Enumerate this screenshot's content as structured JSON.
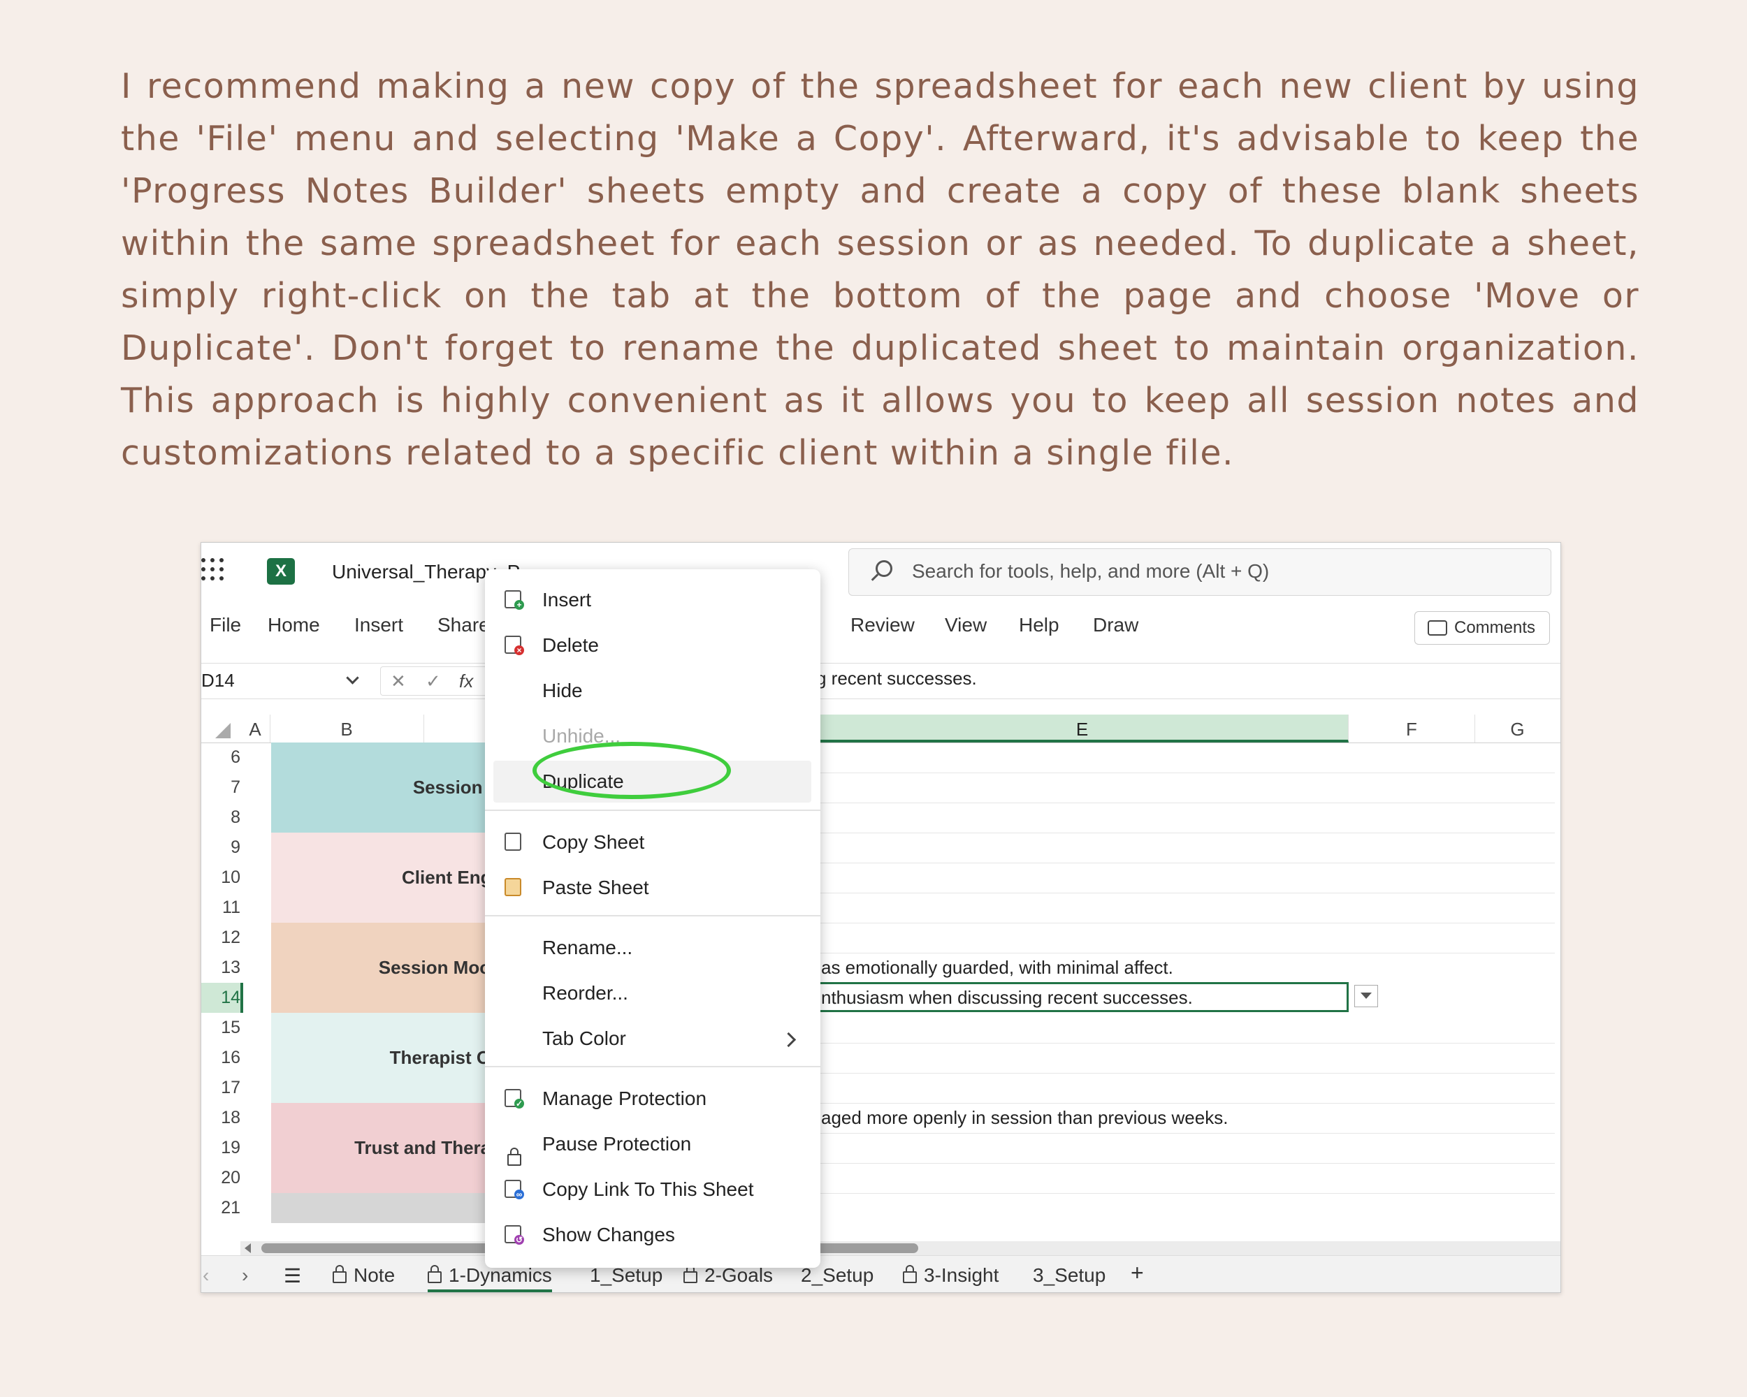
{
  "intro": {
    "text": "I recommend making a new copy of the spreadsheet for each new client by using the 'File' menu and selecting 'Make a Copy'. Afterward, it's advisable to keep the 'Progress Notes Builder' sheets empty and create a copy of these blank sheets within the same spreadsheet for each session or as needed. To duplicate a sheet, simply right-click on the tab at the bottom of the page and choose 'Move or Duplicate'. Don't forget to rename the duplicated sheet to maintain organization. This approach is highly convenient as it allows you to keep all session notes and customizations related to a specific client within a single file."
  },
  "app": {
    "title": "Universal_Therapy_P",
    "search_placeholder": "Search for tools, help, and more (Alt + Q)",
    "accent": "#217346"
  },
  "ribbon": {
    "tabs": [
      "File",
      "Home",
      "Insert",
      "Share",
      "Review",
      "View",
      "Help",
      "Draw"
    ],
    "comments_label": "Comments"
  },
  "formula": {
    "name_box": "D14",
    "fx": "fx",
    "text": "g recent successes."
  },
  "columns": [
    "A",
    "B",
    "E",
    "F",
    "G"
  ],
  "rows": [
    "6",
    "7",
    "8",
    "9",
    "10",
    "11",
    "12",
    "13",
    "14",
    "15",
    "16",
    "17",
    "18",
    "19",
    "20",
    "21"
  ],
  "sections": [
    {
      "label": "Session O",
      "color": "#b3dcdc"
    },
    {
      "label": "Client Enga",
      "color": "#f7e3e3"
    },
    {
      "label": "Session Mood",
      "color": "#f0d3bf"
    },
    {
      "label": "Therapist Ob",
      "color": "#e3f2f0"
    },
    {
      "label": "Trust and Therap",
      "color": "#f1cfd2"
    }
  ],
  "cells": {
    "r13": "as emotionally guarded, with minimal affect.",
    "r14": "nthusiasm when discussing recent successes.",
    "r18": "aged more openly in session than previous weeks."
  },
  "context_menu": {
    "insert": "Insert",
    "delete": "Delete",
    "hide": "Hide",
    "unhide": "Unhide...",
    "duplicate": "Duplicate",
    "copy_sheet": "Copy Sheet",
    "paste_sheet": "Paste Sheet",
    "rename": "Rename...",
    "reorder": "Reorder...",
    "tab_color": "Tab Color",
    "manage_protection": "Manage Protection",
    "pause_protection": "Pause Protection",
    "copy_link": "Copy Link To This Sheet",
    "show_changes": "Show Changes",
    "highlight_color": "#3fcd3d"
  },
  "sheet_tabs": {
    "note": "Note",
    "dynamics": "1-Dynamics",
    "setup1": "1_Setup",
    "goals": "2-Goals",
    "setup2": "2_Setup",
    "insight": "3-Insight",
    "setup3": "3_Setup",
    "add": "+"
  }
}
